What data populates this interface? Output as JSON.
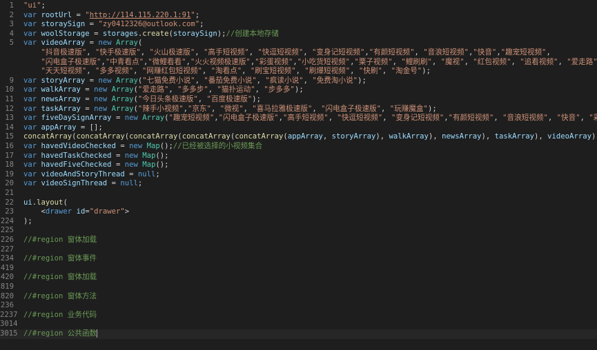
{
  "editor": {
    "lines": [
      {
        "n": "1",
        "tokens": [
          [
            "str",
            "\"ui\""
          ],
          [
            "",
            ";"
          ]
        ]
      },
      {
        "n": "2",
        "tokens": [
          [
            "kw",
            "var "
          ],
          [
            "var",
            "rootUrl"
          ],
          [
            "",
            " = "
          ],
          [
            "str",
            "\""
          ],
          [
            "str link",
            "http://114.115.220.1:91"
          ],
          [
            "str",
            "\""
          ],
          [
            "",
            ";"
          ]
        ]
      },
      {
        "n": "3",
        "tokens": [
          [
            "kw",
            "var "
          ],
          [
            "var",
            "storaySign"
          ],
          [
            "",
            " = "
          ],
          [
            "str",
            "\"zy0412326@outlook.com\""
          ],
          [
            "",
            ";"
          ]
        ]
      },
      {
        "n": "4",
        "tokens": [
          [
            "kw",
            "var "
          ],
          [
            "var",
            "woolStorage"
          ],
          [
            "",
            " = "
          ],
          [
            "var",
            "storages"
          ],
          [
            "",
            "."
          ],
          [
            "fn",
            "create"
          ],
          [
            "",
            "("
          ],
          [
            "var",
            "storaySign"
          ],
          [
            "",
            ");"
          ],
          [
            "com",
            "//创建本地存储"
          ]
        ]
      },
      {
        "n": "5",
        "tokens": [
          [
            "kw",
            "var "
          ],
          [
            "var",
            "videoArray"
          ],
          [
            "",
            " = "
          ],
          [
            "kw",
            "new "
          ],
          [
            "cls",
            "Array"
          ],
          [
            "",
            "("
          ]
        ]
      },
      {
        "n": "",
        "tokens": [
          [
            "",
            "    "
          ],
          [
            "str",
            "\"抖音极速版\""
          ],
          [
            "",
            ", "
          ],
          [
            "str",
            "\"快手极速版\""
          ],
          [
            "",
            ", "
          ],
          [
            "str",
            "\"火山极速版\""
          ],
          [
            "",
            ", "
          ],
          [
            "str",
            "\"高手短视频\""
          ],
          [
            "",
            ", "
          ],
          [
            "str",
            "\"快逗短视频\""
          ],
          [
            "",
            ", "
          ],
          [
            "str",
            "\"变身记短视频\""
          ],
          [
            "",
            ","
          ],
          [
            "str",
            "\"有颜短视频\""
          ],
          [
            "",
            ", "
          ],
          [
            "str",
            "\"音浪短视频\""
          ],
          [
            "",
            ","
          ],
          [
            "str",
            "\"快音\""
          ],
          [
            "",
            ","
          ],
          [
            "str",
            "\"趣宠短视频\""
          ],
          [
            "",
            ","
          ]
        ]
      },
      {
        "n": "",
        "tokens": [
          [
            "",
            "    "
          ],
          [
            "str",
            "\"闪电盒子极速版\""
          ],
          [
            "",
            ","
          ],
          [
            "str",
            "\"中青看点\""
          ],
          [
            "",
            ","
          ],
          [
            "str",
            "\"微鲤看看\""
          ],
          [
            "",
            ","
          ],
          [
            "str",
            "\"火火视频极速版\""
          ],
          [
            "",
            ","
          ],
          [
            "str",
            "\"彩蛋视频\""
          ],
          [
            "",
            ","
          ],
          [
            "str",
            "\"小吃货短视频\""
          ],
          [
            "",
            ","
          ],
          [
            "str",
            "\"栗子视频\""
          ],
          [
            "",
            ", "
          ],
          [
            "str",
            "\"鲤刷刷\""
          ],
          [
            "",
            ", "
          ],
          [
            "str",
            "\"魔视\""
          ],
          [
            "",
            ", "
          ],
          [
            "str",
            "\"红包视频\""
          ],
          [
            "",
            ", "
          ],
          [
            "str",
            "\"追看视频\""
          ],
          [
            "",
            ", "
          ],
          [
            "str",
            "\"爱走路\""
          ],
          [
            "",
            ","
          ]
        ]
      },
      {
        "n": "",
        "tokens": [
          [
            "",
            "    "
          ],
          [
            "str",
            "\"天天短视频\""
          ],
          [
            "",
            ", "
          ],
          [
            "str",
            "\"多多视频\""
          ],
          [
            "",
            ", "
          ],
          [
            "str",
            "\"网赚红包短视频\""
          ],
          [
            "",
            ", "
          ],
          [
            "str",
            "\"淘看点\""
          ],
          [
            "",
            ", "
          ],
          [
            "str",
            "\"刷宝短视频\""
          ],
          [
            "",
            ", "
          ],
          [
            "str",
            "\"刷爆短视频\""
          ],
          [
            "",
            ", "
          ],
          [
            "str",
            "\"快刷\""
          ],
          [
            "",
            ", "
          ],
          [
            "str",
            "\"淘金号\""
          ],
          [
            "",
            ");"
          ]
        ]
      },
      {
        "n": "9",
        "tokens": [
          [
            "kw",
            "var "
          ],
          [
            "var",
            "storyArray"
          ],
          [
            "",
            " = "
          ],
          [
            "kw",
            "new "
          ],
          [
            "cls",
            "Array"
          ],
          [
            "",
            "("
          ],
          [
            "str",
            "\"七猫免费小说\""
          ],
          [
            "",
            ", "
          ],
          [
            "str",
            "\"番茄免费小说\""
          ],
          [
            "",
            ", "
          ],
          [
            "str",
            "\"疯读小说\""
          ],
          [
            "",
            ", "
          ],
          [
            "str",
            "\"免费淘小说\""
          ],
          [
            "",
            ");"
          ]
        ]
      },
      {
        "n": "10",
        "tokens": [
          [
            "kw",
            "var "
          ],
          [
            "var",
            "walkArray"
          ],
          [
            "",
            " = "
          ],
          [
            "kw",
            "new "
          ],
          [
            "cls",
            "Array"
          ],
          [
            "",
            "("
          ],
          [
            "str",
            "\"爱走路\""
          ],
          [
            "",
            ", "
          ],
          [
            "str",
            "\"多多步\""
          ],
          [
            "",
            ", "
          ],
          [
            "str",
            "\"猫扑运动\""
          ],
          [
            "",
            ", "
          ],
          [
            "str",
            "\"步多多\""
          ],
          [
            "",
            ");"
          ]
        ]
      },
      {
        "n": "11",
        "tokens": [
          [
            "kw",
            "var "
          ],
          [
            "var",
            "newsArray"
          ],
          [
            "",
            " = "
          ],
          [
            "kw",
            "new "
          ],
          [
            "cls",
            "Array"
          ],
          [
            "",
            "("
          ],
          [
            "str",
            "\"今日头条极速版\""
          ],
          [
            "",
            ", "
          ],
          [
            "str",
            "\"百度极速版\""
          ],
          [
            "",
            ");"
          ]
        ]
      },
      {
        "n": "12",
        "tokens": [
          [
            "kw",
            "var "
          ],
          [
            "var",
            "taskArray"
          ],
          [
            "",
            " = "
          ],
          [
            "kw",
            "new "
          ],
          [
            "cls",
            "Array"
          ],
          [
            "",
            "("
          ],
          [
            "str",
            "\"辣手小视频\""
          ],
          [
            "",
            ","
          ],
          [
            "str",
            "\"京东\""
          ],
          [
            "",
            ", "
          ],
          [
            "str",
            "\"微视\""
          ],
          [
            "",
            ", "
          ],
          [
            "str",
            "\"喜马拉雅极速版\""
          ],
          [
            "",
            ", "
          ],
          [
            "str",
            "\"闪电盒子极速版\""
          ],
          [
            "",
            ", "
          ],
          [
            "str",
            "\"玩赚魔盒\""
          ],
          [
            "",
            ");"
          ]
        ]
      },
      {
        "n": "13",
        "tokens": [
          [
            "kw",
            "var "
          ],
          [
            "var",
            "fiveDaySignArray"
          ],
          [
            "",
            " = "
          ],
          [
            "kw",
            "new "
          ],
          [
            "cls",
            "Array"
          ],
          [
            "",
            "("
          ],
          [
            "str",
            "\"趣宠短视频\""
          ],
          [
            "",
            ","
          ],
          [
            "str",
            "\"闪电盒子极速版\""
          ],
          [
            "",
            ","
          ],
          [
            "str",
            "\"高手短视频\""
          ],
          [
            "",
            ", "
          ],
          [
            "str",
            "\"快逗短视频\""
          ],
          [
            "",
            ", "
          ],
          [
            "str",
            "\"变身记短视频\""
          ],
          [
            "",
            ","
          ],
          [
            "str",
            "\"有颜短视频\""
          ],
          [
            "",
            ", "
          ],
          [
            "str",
            "\"音浪短视频\""
          ],
          [
            "",
            ", "
          ],
          [
            "str",
            "\"快音\""
          ],
          [
            "",
            ", "
          ],
          [
            "str",
            "\"彩蛋视频\""
          ],
          [
            "",
            ", "
          ],
          [
            "str",
            "\"鲤"
          ]
        ]
      },
      {
        "n": "14",
        "tokens": [
          [
            "kw",
            "var "
          ],
          [
            "var",
            "appArray"
          ],
          [
            "",
            " = [];"
          ]
        ]
      },
      {
        "n": "15",
        "tokens": [
          [
            "fn",
            "concatArray"
          ],
          [
            "",
            "("
          ],
          [
            "fn",
            "concatArray"
          ],
          [
            "",
            "("
          ],
          [
            "fn",
            "concatArray"
          ],
          [
            "",
            "("
          ],
          [
            "fn",
            "concatArray"
          ],
          [
            "",
            "("
          ],
          [
            "fn",
            "concatArray"
          ],
          [
            "",
            "("
          ],
          [
            "var",
            "appArray"
          ],
          [
            "",
            ", "
          ],
          [
            "var",
            "storyArray"
          ],
          [
            "",
            "), "
          ],
          [
            "var",
            "walkArray"
          ],
          [
            "",
            "), "
          ],
          [
            "var",
            "newsArray"
          ],
          [
            "",
            "), "
          ],
          [
            "var",
            "taskArray"
          ],
          [
            "",
            "), "
          ],
          [
            "var",
            "videoArray"
          ],
          [
            "",
            ");"
          ]
        ]
      },
      {
        "n": "16",
        "tokens": [
          [
            "kw",
            "var "
          ],
          [
            "var",
            "havedVideoChecked"
          ],
          [
            "",
            " = "
          ],
          [
            "kw",
            "new "
          ],
          [
            "cls",
            "Map"
          ],
          [
            "",
            "();"
          ],
          [
            "com",
            "//已经被选择的小视频集合"
          ]
        ]
      },
      {
        "n": "17",
        "tokens": [
          [
            "kw",
            "var "
          ],
          [
            "var",
            "havedTaskChecked"
          ],
          [
            "",
            " = "
          ],
          [
            "kw",
            "new "
          ],
          [
            "cls",
            "Map"
          ],
          [
            "",
            "();"
          ]
        ]
      },
      {
        "n": "18",
        "tokens": [
          [
            "kw",
            "var "
          ],
          [
            "var",
            "havedFiveChecked"
          ],
          [
            "",
            " = "
          ],
          [
            "kw",
            "new "
          ],
          [
            "cls",
            "Map"
          ],
          [
            "",
            "();"
          ]
        ]
      },
      {
        "n": "19",
        "tokens": [
          [
            "kw",
            "var "
          ],
          [
            "var",
            "videoAndStoryThread"
          ],
          [
            "",
            " = "
          ],
          [
            "kw",
            "null"
          ],
          [
            "",
            ";"
          ]
        ]
      },
      {
        "n": "20",
        "tokens": [
          [
            "kw",
            "var "
          ],
          [
            "var",
            "videoSignThread"
          ],
          [
            "",
            " = "
          ],
          [
            "kw",
            "null"
          ],
          [
            "",
            ";"
          ]
        ]
      },
      {
        "n": "21",
        "tokens": []
      },
      {
        "n": "22",
        "tokens": [
          [
            "var",
            "ui"
          ],
          [
            "",
            "."
          ],
          [
            "fn",
            "layout"
          ],
          [
            "",
            "("
          ]
        ]
      },
      {
        "n": "23",
        "tokens": [
          [
            "",
            "    <"
          ],
          [
            "tag",
            "drawer"
          ],
          [
            "",
            " "
          ],
          [
            "attr",
            "id"
          ],
          [
            "",
            "="
          ],
          [
            "str",
            "\"drawer\""
          ],
          [
            "",
            ">"
          ]
        ]
      },
      {
        "n": "224",
        "tokens": [
          [
            "",
            ");"
          ]
        ]
      },
      {
        "n": "225",
        "tokens": []
      },
      {
        "n": "226",
        "tokens": [
          [
            "com",
            "//#region 窗体加载"
          ]
        ]
      },
      {
        "n": "227",
        "tokens": []
      },
      {
        "n": "234",
        "tokens": [
          [
            "com",
            "//#region 窗体事件"
          ]
        ]
      },
      {
        "n": "419",
        "tokens": []
      },
      {
        "n": "420",
        "tokens": [
          [
            "com",
            "//#region 窗体加载"
          ]
        ]
      },
      {
        "n": "819",
        "tokens": []
      },
      {
        "n": "820",
        "tokens": [
          [
            "com",
            "//#region 窗体方法"
          ]
        ]
      },
      {
        "n": "236",
        "tokens": []
      },
      {
        "n": "2237",
        "tokens": [
          [
            "com",
            "//#region 业务代码"
          ]
        ]
      },
      {
        "n": "3014",
        "tokens": []
      },
      {
        "n": "3015",
        "tokens": [
          [
            "com",
            "//#region 公共函数"
          ]
        ],
        "current": true
      }
    ]
  }
}
